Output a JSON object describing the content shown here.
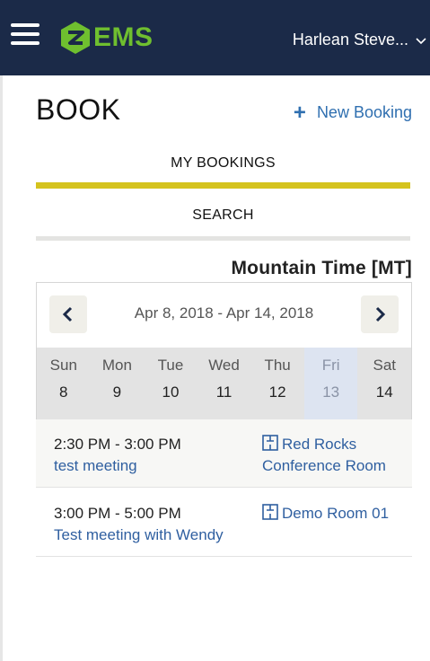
{
  "header": {
    "logo_text": "EMS",
    "user_name": "Harlean Steve...",
    "brand_color": "#6fbf2f",
    "bar_color": "#1b2a48"
  },
  "page": {
    "title": "BOOK",
    "new_booking_label": "New Booking"
  },
  "tabs": [
    {
      "label": "MY BOOKINGS",
      "active": true
    },
    {
      "label": "SEARCH",
      "active": false
    }
  ],
  "timezone": "Mountain Time [MT]",
  "calendar": {
    "range": "Apr 8, 2018 - Apr 14, 2018",
    "days": [
      {
        "name": "Sun",
        "date": "8"
      },
      {
        "name": "Mon",
        "date": "9"
      },
      {
        "name": "Tue",
        "date": "10"
      },
      {
        "name": "Wed",
        "date": "11"
      },
      {
        "name": "Thu",
        "date": "12"
      },
      {
        "name": "Fri",
        "date": "13",
        "today": true
      },
      {
        "name": "Sat",
        "date": "14"
      }
    ]
  },
  "bookings": [
    {
      "time": "2:30 PM - 3:00 PM",
      "title": "test meeting",
      "room_line1": "Red Rocks",
      "room_line2": "Conference Room"
    },
    {
      "time": "3:00 PM - 5:00 PM",
      "title": "Test meeting with Wendy",
      "room_line1": "Demo Room 01",
      "room_line2": ""
    }
  ]
}
